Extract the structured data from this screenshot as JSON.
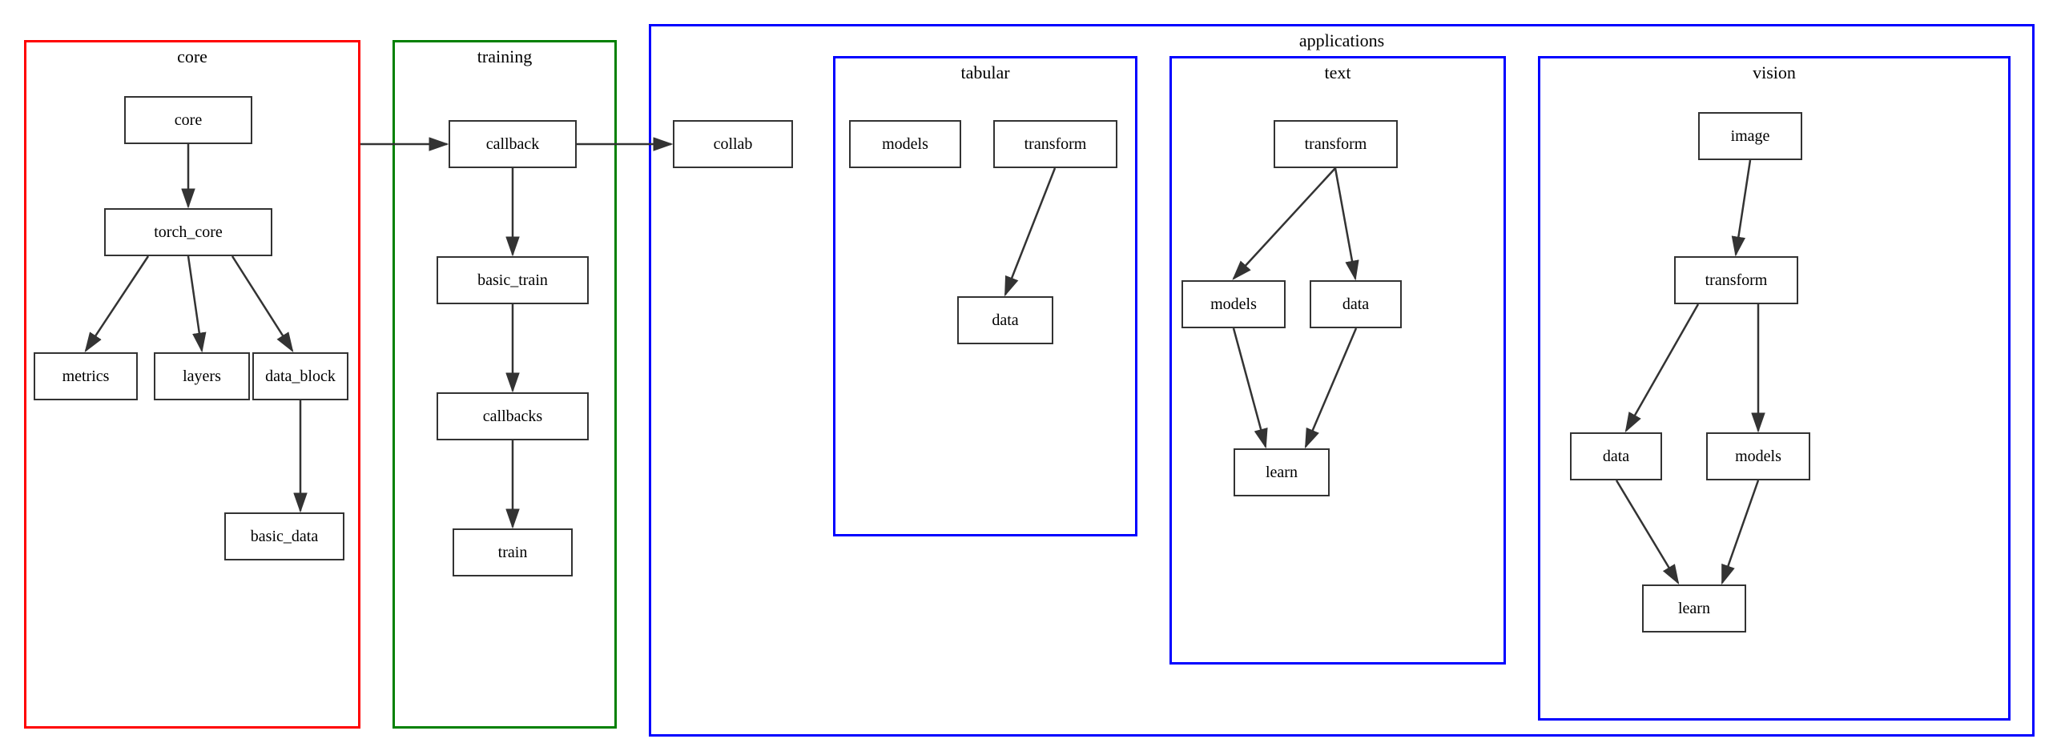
{
  "sections": {
    "core": {
      "label": "core",
      "border": "red",
      "nodes": {
        "core": {
          "text": "core"
        },
        "torch_core": {
          "text": "torch_core"
        },
        "metrics": {
          "text": "metrics"
        },
        "layers": {
          "text": "layers"
        },
        "data_block": {
          "text": "data_block"
        },
        "basic_data": {
          "text": "basic_data"
        }
      }
    },
    "training": {
      "label": "training",
      "border": "green",
      "nodes": {
        "callback": {
          "text": "callback"
        },
        "basic_train": {
          "text": "basic_train"
        },
        "callbacks": {
          "text": "callbacks"
        },
        "train": {
          "text": "train"
        }
      }
    },
    "applications": {
      "label": "applications",
      "border": "blue",
      "sub": {
        "collab": {
          "text": "collab"
        },
        "tabular": {
          "label": "tabular",
          "nodes": {
            "models": "models",
            "transform": "transform",
            "data": "data"
          }
        },
        "text": {
          "label": "text",
          "nodes": {
            "transform": "transform",
            "models": "models",
            "data": "data",
            "learn": "learn"
          }
        },
        "vision": {
          "label": "vision",
          "nodes": {
            "image": "image",
            "transform": "transform",
            "data": "data",
            "models": "models",
            "learn": "learn"
          }
        }
      }
    }
  }
}
